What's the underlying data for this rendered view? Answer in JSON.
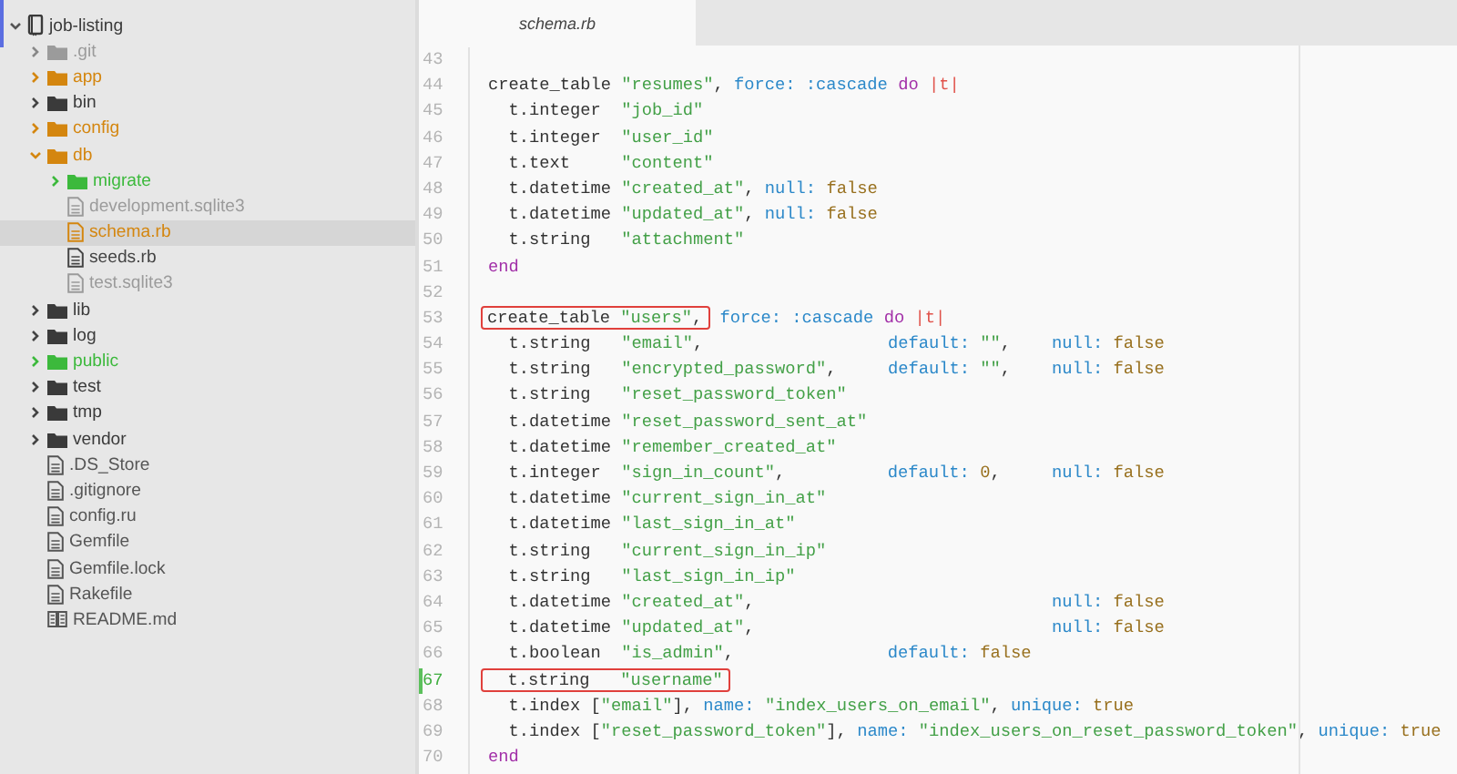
{
  "sidebar": {
    "root": {
      "label": "job-listing",
      "kind": "repo",
      "expanded": true,
      "selected": false,
      "color": "#3a3a3a",
      "children": [
        {
          "label": ".git",
          "kind": "folder",
          "expanded": false,
          "selected": false,
          "color": "#9b9b9b"
        },
        {
          "label": "app",
          "kind": "folder",
          "expanded": false,
          "selected": false,
          "color": "#d4860f"
        },
        {
          "label": "bin",
          "kind": "folder",
          "expanded": false,
          "selected": false,
          "color": "#3a3a3a"
        },
        {
          "label": "config",
          "kind": "folder",
          "expanded": false,
          "selected": false,
          "color": "#d4860f"
        },
        {
          "label": "db",
          "kind": "folder",
          "expanded": true,
          "selected": false,
          "color": "#d4860f",
          "children": [
            {
              "label": "migrate",
              "kind": "folder",
              "expanded": false,
              "selected": false,
              "color": "#3cb93c"
            },
            {
              "label": "development.sqlite3",
              "kind": "file",
              "selected": false,
              "color": "#9b9b9b"
            },
            {
              "label": "schema.rb",
              "kind": "file",
              "selected": true,
              "color": "#d4860f"
            },
            {
              "label": "seeds.rb",
              "kind": "file",
              "selected": false,
              "color": "#444444"
            },
            {
              "label": "test.sqlite3",
              "kind": "file",
              "selected": false,
              "color": "#9b9b9b"
            }
          ]
        },
        {
          "label": "lib",
          "kind": "folder",
          "expanded": false,
          "selected": false,
          "color": "#3a3a3a"
        },
        {
          "label": "log",
          "kind": "folder",
          "expanded": false,
          "selected": false,
          "color": "#3a3a3a"
        },
        {
          "label": "public",
          "kind": "folder",
          "expanded": false,
          "selected": false,
          "color": "#3cb93c"
        },
        {
          "label": "test",
          "kind": "folder",
          "expanded": false,
          "selected": false,
          "color": "#3a3a3a"
        },
        {
          "label": "tmp",
          "kind": "folder",
          "expanded": false,
          "selected": false,
          "color": "#3a3a3a"
        },
        {
          "label": "vendor",
          "kind": "folder",
          "expanded": false,
          "selected": false,
          "color": "#3a3a3a"
        },
        {
          "label": ".DS_Store",
          "kind": "file",
          "selected": false,
          "color": "#555555"
        },
        {
          "label": ".gitignore",
          "kind": "file",
          "selected": false,
          "color": "#555555"
        },
        {
          "label": "config.ru",
          "kind": "file",
          "selected": false,
          "color": "#555555"
        },
        {
          "label": "Gemfile",
          "kind": "file",
          "selected": false,
          "color": "#555555"
        },
        {
          "label": "Gemfile.lock",
          "kind": "file",
          "selected": false,
          "color": "#555555"
        },
        {
          "label": "Rakefile",
          "kind": "file",
          "selected": false,
          "color": "#555555"
        },
        {
          "label": "README.md",
          "kind": "markdown",
          "selected": false,
          "color": "#555555"
        }
      ]
    }
  },
  "editor": {
    "tabs": [
      {
        "label": "schema.rb",
        "selected": true
      }
    ],
    "lines": [
      {
        "number": "43",
        "changed": false
      },
      {
        "number": "44",
        "changed": false,
        "tokens": [
          {
            "kind": "plain",
            "text": "create_table "
          },
          {
            "kind": "string",
            "text": "\"resumes\""
          },
          {
            "kind": "plain",
            "text": ", "
          },
          {
            "kind": "symbol",
            "text": "force: :cascade "
          },
          {
            "kind": "keyword",
            "text": "do "
          },
          {
            "kind": "param",
            "text": "|t|"
          }
        ]
      },
      {
        "number": "45",
        "changed": false,
        "tokens": [
          {
            "kind": "plain",
            "text": "  t.integer  "
          },
          {
            "kind": "string",
            "text": "\"job_id\""
          }
        ]
      },
      {
        "number": "46",
        "changed": false,
        "tokens": [
          {
            "kind": "plain",
            "text": "  t.integer  "
          },
          {
            "kind": "string",
            "text": "\"user_id\""
          }
        ]
      },
      {
        "number": "47",
        "changed": false,
        "tokens": [
          {
            "kind": "plain",
            "text": "  t.text     "
          },
          {
            "kind": "string",
            "text": "\"content\""
          }
        ]
      },
      {
        "number": "48",
        "changed": false,
        "tokens": [
          {
            "kind": "plain",
            "text": "  t.datetime "
          },
          {
            "kind": "string",
            "text": "\"created_at\""
          },
          {
            "kind": "plain",
            "text": ", "
          },
          {
            "kind": "symbol",
            "text": "null: "
          },
          {
            "kind": "constant",
            "text": "false"
          }
        ]
      },
      {
        "number": "49",
        "changed": false,
        "tokens": [
          {
            "kind": "plain",
            "text": "  t.datetime "
          },
          {
            "kind": "string",
            "text": "\"updated_at\""
          },
          {
            "kind": "plain",
            "text": ", "
          },
          {
            "kind": "symbol",
            "text": "null: "
          },
          {
            "kind": "constant",
            "text": "false"
          }
        ]
      },
      {
        "number": "50",
        "changed": false,
        "tokens": [
          {
            "kind": "plain",
            "text": "  t.string   "
          },
          {
            "kind": "string",
            "text": "\"attachment\""
          }
        ]
      },
      {
        "number": "51",
        "changed": false,
        "tokens": [
          {
            "kind": "keyword",
            "text": "end"
          }
        ]
      },
      {
        "number": "52",
        "changed": false
      },
      {
        "number": "53",
        "changed": false,
        "marked": [
          {
            "kind": "plain",
            "text": "create_table "
          },
          {
            "kind": "string",
            "text": "\"users\""
          },
          {
            "kind": "plain",
            "text": ","
          }
        ],
        "tokens": [
          {
            "kind": "symbol",
            "text": " force: :cascade "
          },
          {
            "kind": "keyword",
            "text": "do "
          },
          {
            "kind": "param",
            "text": "|t|"
          }
        ]
      },
      {
        "number": "54",
        "changed": false,
        "tokens": [
          {
            "kind": "plain",
            "text": "  t.string   "
          },
          {
            "kind": "string",
            "text": "\"email\""
          },
          {
            "kind": "plain",
            "text": ",                  "
          },
          {
            "kind": "symbol",
            "text": "default: "
          },
          {
            "kind": "string",
            "text": "\"\""
          },
          {
            "kind": "plain",
            "text": ",    "
          },
          {
            "kind": "symbol",
            "text": "null: "
          },
          {
            "kind": "constant",
            "text": "false"
          }
        ]
      },
      {
        "number": "55",
        "changed": false,
        "tokens": [
          {
            "kind": "plain",
            "text": "  t.string   "
          },
          {
            "kind": "string",
            "text": "\"encrypted_password\""
          },
          {
            "kind": "plain",
            "text": ",     "
          },
          {
            "kind": "symbol",
            "text": "default: "
          },
          {
            "kind": "string",
            "text": "\"\""
          },
          {
            "kind": "plain",
            "text": ",    "
          },
          {
            "kind": "symbol",
            "text": "null: "
          },
          {
            "kind": "constant",
            "text": "false"
          }
        ]
      },
      {
        "number": "56",
        "changed": false,
        "tokens": [
          {
            "kind": "plain",
            "text": "  t.string   "
          },
          {
            "kind": "string",
            "text": "\"reset_password_token\""
          }
        ]
      },
      {
        "number": "57",
        "changed": false,
        "tokens": [
          {
            "kind": "plain",
            "text": "  t.datetime "
          },
          {
            "kind": "string",
            "text": "\"reset_password_sent_at\""
          }
        ]
      },
      {
        "number": "58",
        "changed": false,
        "tokens": [
          {
            "kind": "plain",
            "text": "  t.datetime "
          },
          {
            "kind": "string",
            "text": "\"remember_created_at\""
          }
        ]
      },
      {
        "number": "59",
        "changed": false,
        "tokens": [
          {
            "kind": "plain",
            "text": "  t.integer  "
          },
          {
            "kind": "string",
            "text": "\"sign_in_count\""
          },
          {
            "kind": "plain",
            "text": ",          "
          },
          {
            "kind": "symbol",
            "text": "default: "
          },
          {
            "kind": "constant",
            "text": "0"
          },
          {
            "kind": "plain",
            "text": ",     "
          },
          {
            "kind": "symbol",
            "text": "null: "
          },
          {
            "kind": "constant",
            "text": "false"
          }
        ]
      },
      {
        "number": "60",
        "changed": false,
        "tokens": [
          {
            "kind": "plain",
            "text": "  t.datetime "
          },
          {
            "kind": "string",
            "text": "\"current_sign_in_at\""
          }
        ]
      },
      {
        "number": "61",
        "changed": false,
        "tokens": [
          {
            "kind": "plain",
            "text": "  t.datetime "
          },
          {
            "kind": "string",
            "text": "\"last_sign_in_at\""
          }
        ]
      },
      {
        "number": "62",
        "changed": false,
        "tokens": [
          {
            "kind": "plain",
            "text": "  t.string   "
          },
          {
            "kind": "string",
            "text": "\"current_sign_in_ip\""
          }
        ]
      },
      {
        "number": "63",
        "changed": false,
        "tokens": [
          {
            "kind": "plain",
            "text": "  t.string   "
          },
          {
            "kind": "string",
            "text": "\"last_sign_in_ip\""
          }
        ]
      },
      {
        "number": "64",
        "changed": false,
        "tokens": [
          {
            "kind": "plain",
            "text": "  t.datetime "
          },
          {
            "kind": "string",
            "text": "\"created_at\""
          },
          {
            "kind": "plain",
            "text": ",                             "
          },
          {
            "kind": "symbol",
            "text": "null: "
          },
          {
            "kind": "constant",
            "text": "false"
          }
        ]
      },
      {
        "number": "65",
        "changed": false,
        "tokens": [
          {
            "kind": "plain",
            "text": "  t.datetime "
          },
          {
            "kind": "string",
            "text": "\"updated_at\""
          },
          {
            "kind": "plain",
            "text": ",                             "
          },
          {
            "kind": "symbol",
            "text": "null: "
          },
          {
            "kind": "constant",
            "text": "false"
          }
        ]
      },
      {
        "number": "66",
        "changed": false,
        "tokens": [
          {
            "kind": "plain",
            "text": "  t.boolean  "
          },
          {
            "kind": "string",
            "text": "\"is_admin\""
          },
          {
            "kind": "plain",
            "text": ",               "
          },
          {
            "kind": "symbol",
            "text": "default: "
          },
          {
            "kind": "constant",
            "text": "false"
          }
        ]
      },
      {
        "number": "67",
        "changed": true,
        "marked": [
          {
            "kind": "plain",
            "text": "  t.string   "
          },
          {
            "kind": "string",
            "text": "\"username\""
          }
        ]
      },
      {
        "number": "68",
        "changed": false,
        "tokens": [
          {
            "kind": "plain",
            "text": "  t.index ["
          },
          {
            "kind": "string",
            "text": "\"email\""
          },
          {
            "kind": "plain",
            "text": "], "
          },
          {
            "kind": "symbol",
            "text": "name: "
          },
          {
            "kind": "string",
            "text": "\"index_users_on_email\""
          },
          {
            "kind": "plain",
            "text": ", "
          },
          {
            "kind": "symbol",
            "text": "unique: "
          },
          {
            "kind": "constant",
            "text": "true"
          }
        ]
      },
      {
        "number": "69",
        "changed": false,
        "tokens": [
          {
            "kind": "plain",
            "text": "  t.index ["
          },
          {
            "kind": "string",
            "text": "\"reset_password_token\""
          },
          {
            "kind": "plain",
            "text": "], "
          },
          {
            "kind": "symbol",
            "text": "name: "
          },
          {
            "kind": "string",
            "text": "\"index_users_on_reset_password_token\""
          },
          {
            "kind": "plain",
            "text": ", "
          },
          {
            "kind": "symbol",
            "text": "unique: "
          },
          {
            "kind": "constant",
            "text": "true"
          }
        ]
      },
      {
        "number": "70",
        "changed": false,
        "tokens": [
          {
            "kind": "keyword",
            "text": "end"
          }
        ]
      }
    ]
  }
}
